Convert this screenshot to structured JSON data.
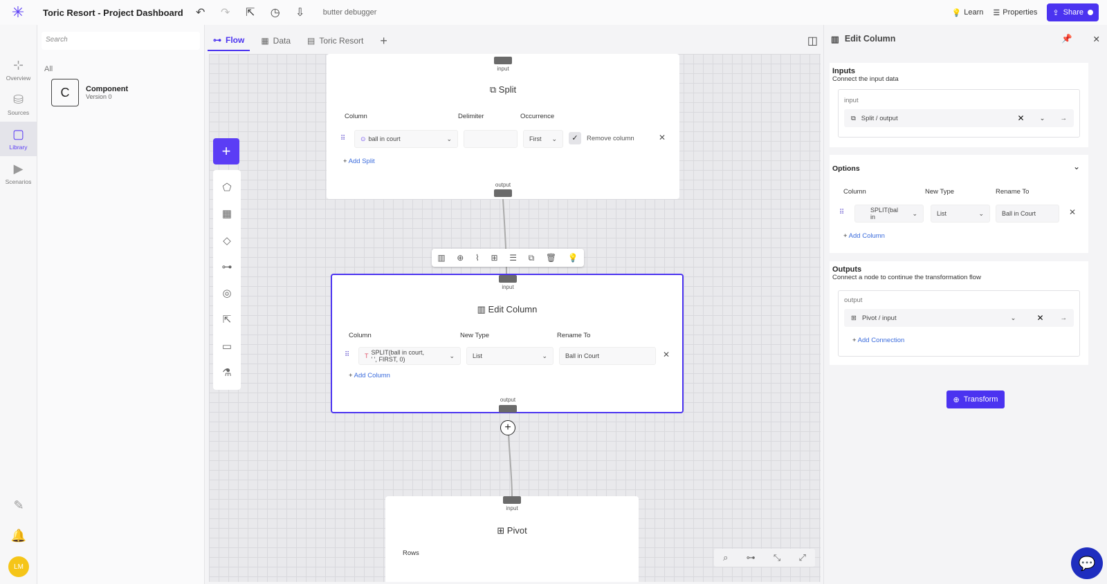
{
  "app": {
    "title": "Toric Resort - Project Dashboard",
    "debug_label": "butter debugger"
  },
  "topbar": {
    "learn": "Learn",
    "properties": "Properties",
    "share": "Share"
  },
  "rail": {
    "items": [
      {
        "label": "Overview",
        "icon": "overview-icon"
      },
      {
        "label": "Sources",
        "icon": "database-icon"
      },
      {
        "label": "Library",
        "icon": "library-icon"
      },
      {
        "label": "Scenarios",
        "icon": "play-icon"
      }
    ],
    "avatar": "LM"
  },
  "library": {
    "search_placeholder": "Search",
    "section": "All",
    "component": {
      "letter": "C",
      "name": "Component",
      "version": "Version 0"
    }
  },
  "tabs": [
    {
      "label": "Flow"
    },
    {
      "label": "Data"
    },
    {
      "label": "Toric Resort"
    }
  ],
  "canvas": {
    "split_node": {
      "title": "Split",
      "input_label": "input",
      "output_label": "output",
      "col_column": "Column",
      "col_delimiter": "Delimiter",
      "col_occurrence": "Occurrence",
      "column_value": "ball in court",
      "occurrence_value": "First",
      "remove_column": "Remove column",
      "add_split": "Add Split"
    },
    "edit_node": {
      "title": "Edit Column",
      "input_label": "input",
      "output_label": "output",
      "col_column": "Column",
      "col_new_type": "New Type",
      "col_rename": "Rename To",
      "column_value_1": "SPLIT(ball in court,",
      "column_value_2": "' ', FIRST, 0)",
      "type_value": "List",
      "rename_value": "Ball in Court",
      "add_column": "Add Column"
    },
    "pivot_node": {
      "title": "Pivot",
      "input_label": "input",
      "rows": "Rows"
    }
  },
  "panel": {
    "title": "Edit Column",
    "inputs_title": "Inputs",
    "inputs_sub": "Connect the input data",
    "input_label": "input",
    "input_value": "Split / output",
    "options_title": "Options",
    "opt_column": "Column",
    "opt_new_type": "New Type",
    "opt_rename": "Rename To",
    "opt_column_value_1": "SPLIT(bal",
    "opt_column_value_2": "in",
    "opt_type_value": "List",
    "opt_rename_value": "Ball in Court",
    "add_column": "Add Column",
    "outputs_title": "Outputs",
    "outputs_sub": "Connect a node to continue the transformation flow",
    "output_label": "output",
    "output_value": "Pivot / input",
    "add_connection": "Add Connection",
    "transform": "Transform"
  }
}
